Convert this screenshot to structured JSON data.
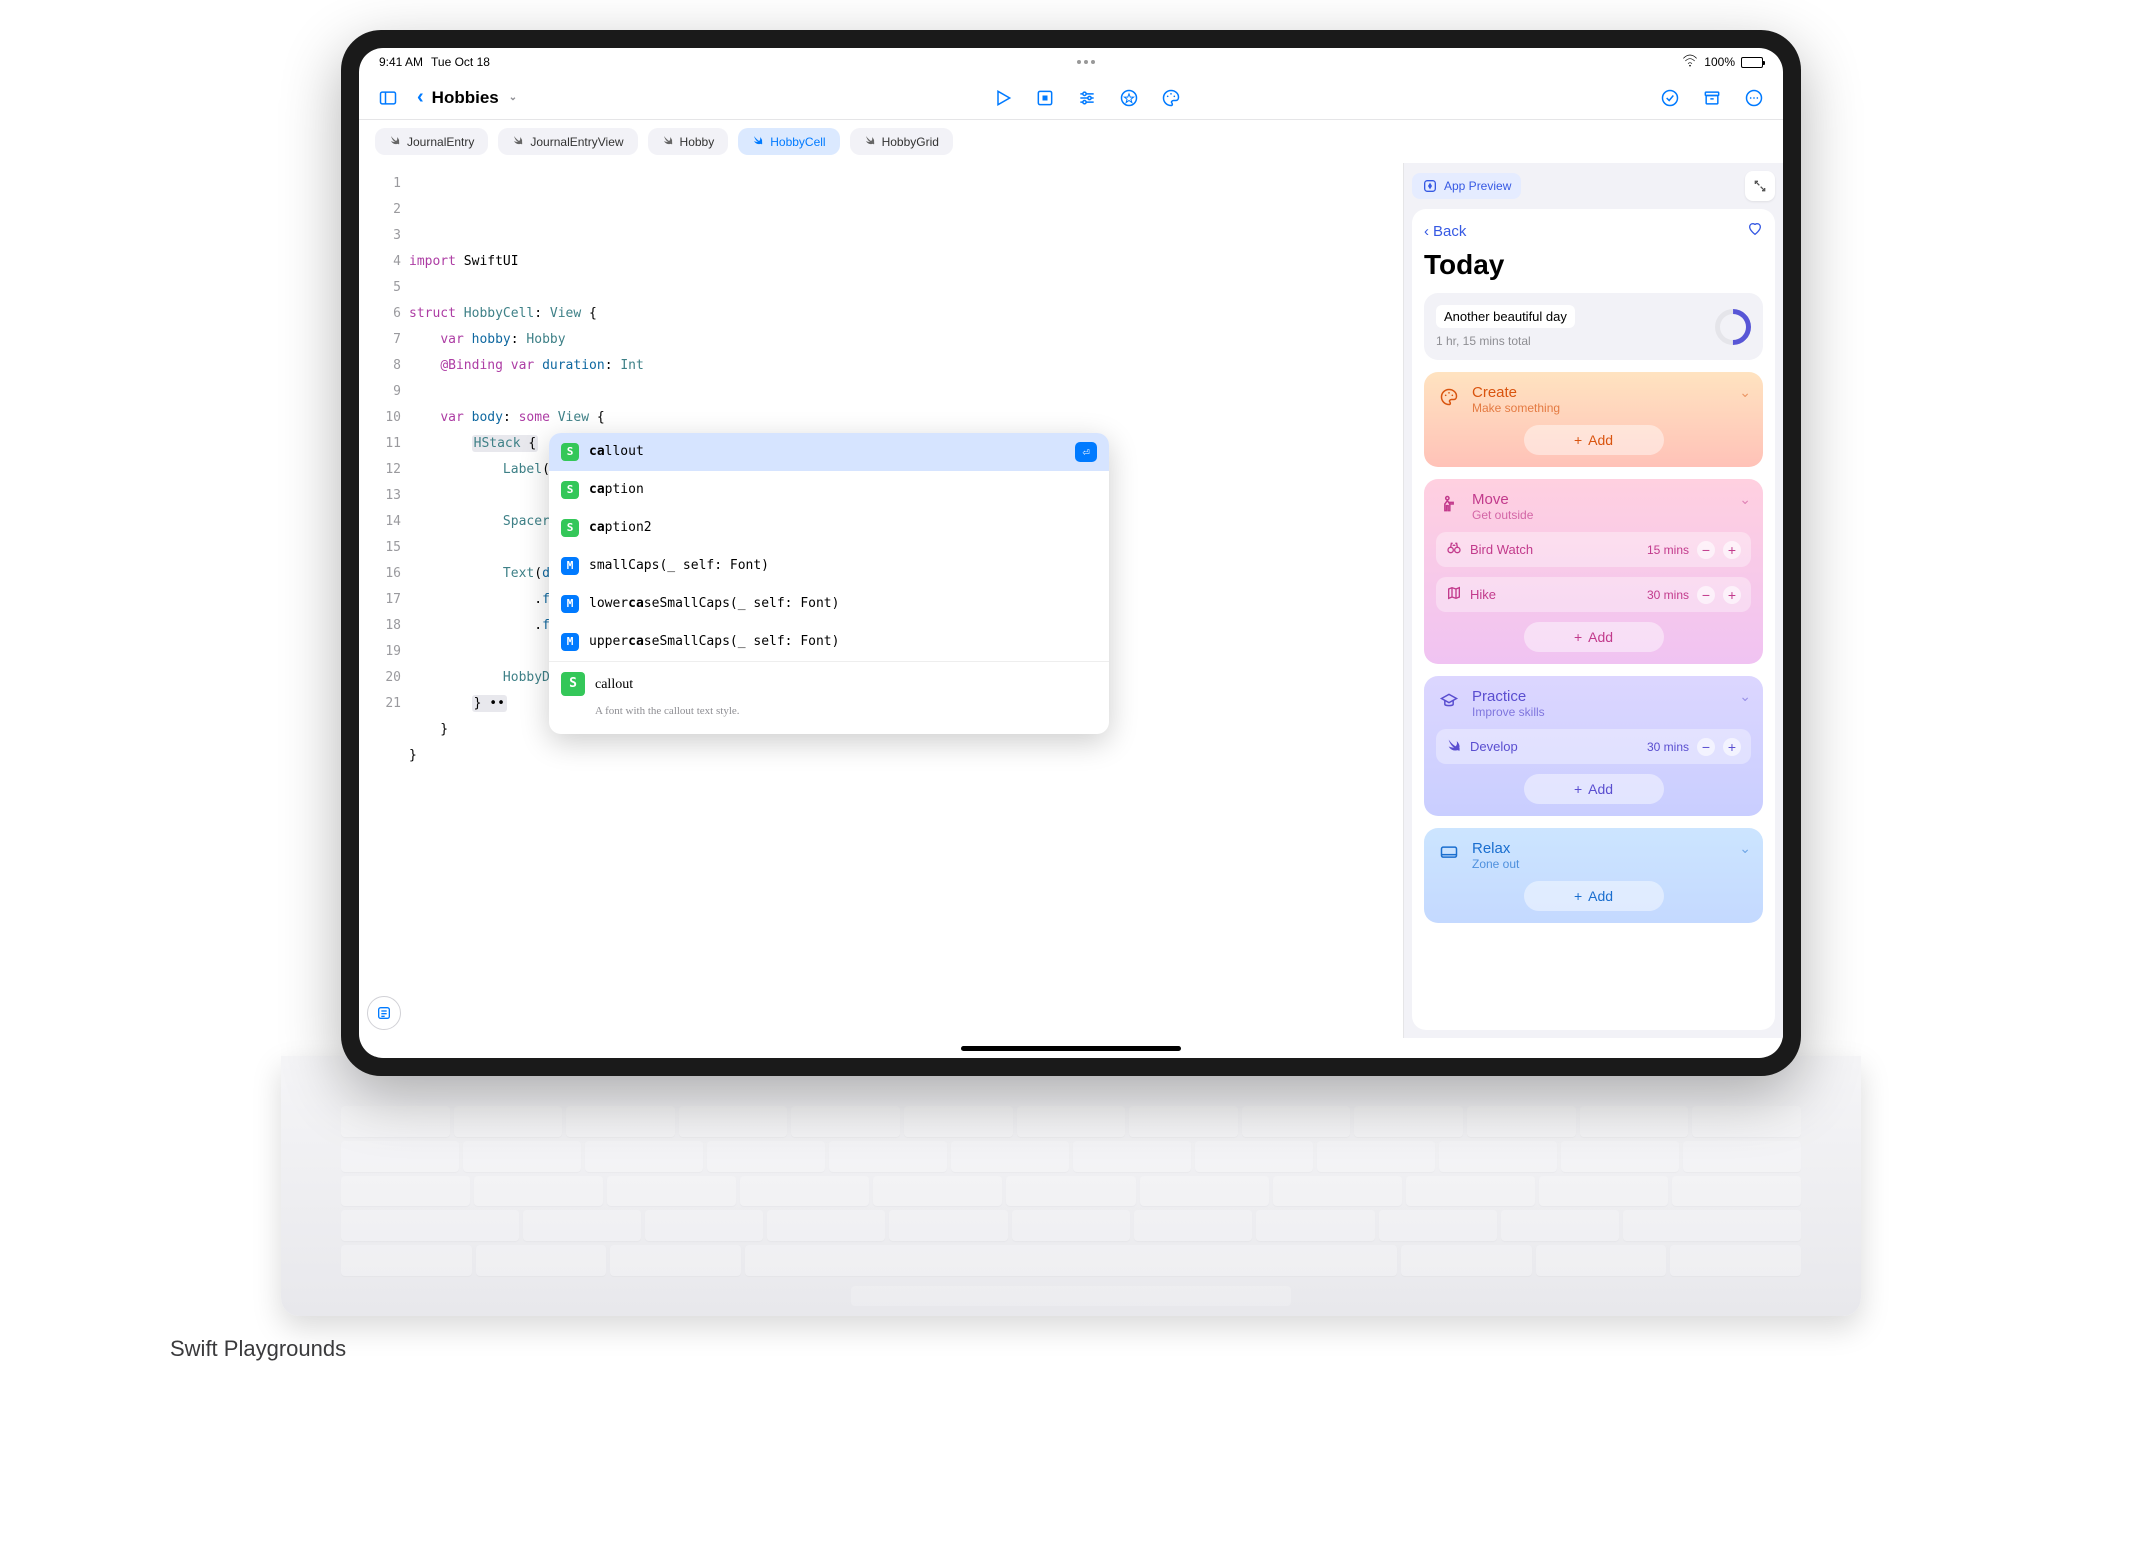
{
  "status": {
    "time": "9:41 AM",
    "date": "Tue Oct 18",
    "wifi": "􀙇",
    "battery": "100%"
  },
  "toolbar": {
    "back_label": "",
    "breadcrumb": "Hobbies"
  },
  "tabs": [
    {
      "label": "JournalEntry",
      "active": false
    },
    {
      "label": "JournalEntryView",
      "active": false
    },
    {
      "label": "Hobby",
      "active": false
    },
    {
      "label": "HobbyCell",
      "active": true
    },
    {
      "label": "HobbyGrid",
      "active": false
    }
  ],
  "code_lines": [
    {
      "n": 1,
      "html": "<span class='kw-pink'>import</span> SwiftUI"
    },
    {
      "n": 2,
      "html": ""
    },
    {
      "n": 3,
      "html": "<span class='kw-pink'>struct</span> <span class='kw-teal'>HobbyCell</span>: <span class='kw-teal'>View</span> {"
    },
    {
      "n": 4,
      "html": "    <span class='kw-pink'>var</span> <span class='kw-blue'>hobby</span>: <span class='kw-teal'>Hobby</span>"
    },
    {
      "n": 5,
      "html": "    <span class='kw-pink'>@Binding</span> <span class='kw-pink'>var</span> <span class='kw-blue'>duration</span>: <span class='kw-teal'>Int</span>"
    },
    {
      "n": 6,
      "html": ""
    },
    {
      "n": 7,
      "html": "    <span class='kw-pink'>var</span> <span class='kw-blue'>body</span>: <span class='kw-pink'>some</span> <span class='kw-teal'>View</span> {"
    },
    {
      "n": 8,
      "html": "        <span class='hl'><span class='kw-teal'>HStack</span> {</span>"
    },
    {
      "n": 9,
      "html": "            <span class='kw-teal'>Label</span>(<span class='kw-blue'>hobby</span>.<span class='kw-blue'>title</span>, systemImage: <span class='kw-blue'>hobby</span>.<span class='kw-blue'>imageName</span>)"
    },
    {
      "n": 10,
      "html": ""
    },
    {
      "n": 11,
      "html": "            <span class='kw-teal'>Spacer</span>()"
    },
    {
      "n": 12,
      "html": ""
    },
    {
      "n": 13,
      "html": "            <span class='kw-teal'>Text</span>(<span class='kw-blue'>duration</span>.<span class='kw-blue'>durationFormatted</span>())"
    },
    {
      "n": 14,
      "html": "                .<span class='kw-blue'>font</span>(.<span class='kw-blue'>ca</span><span class='cursor'></span>)"
    },
    {
      "n": 15,
      "html": "                .<span class='kw-blue'>f</span>"
    },
    {
      "n": 16,
      "html": ""
    },
    {
      "n": 17,
      "html": "            <span class='kw-teal'>HobbyD</span>"
    },
    {
      "n": 18,
      "html": "        <span class='hl'>} ••</span>"
    },
    {
      "n": 19,
      "html": "    }"
    },
    {
      "n": 20,
      "html": "}"
    },
    {
      "n": 21,
      "html": ""
    }
  ],
  "autocomplete": {
    "items": [
      {
        "badge": "S",
        "label_pre": "",
        "label_bold": "ca",
        "label_post": "llout",
        "selected": true,
        "enter": true
      },
      {
        "badge": "S",
        "label_pre": "",
        "label_bold": "ca",
        "label_post": "ption"
      },
      {
        "badge": "S",
        "label_pre": "",
        "label_bold": "ca",
        "label_post": "ption2"
      },
      {
        "badge": "M",
        "label_pre": "smallCaps(_ self: Font)",
        "label_bold": "",
        "label_post": ""
      },
      {
        "badge": "M",
        "label_pre": "lower",
        "label_bold": "ca",
        "label_post": "seSmallCaps(_ self: Font)"
      },
      {
        "badge": "M",
        "label_pre": "upper",
        "label_bold": "ca",
        "label_post": "seSmallCaps(_ self: Font)"
      }
    ],
    "detail": {
      "name": "callout",
      "desc": "A font with the callout text style."
    }
  },
  "preview": {
    "badge": "App Preview",
    "back": "Back",
    "title": "Today",
    "summary": {
      "label": "Another beautiful day",
      "sub": "1 hr, 15 mins total"
    },
    "cards": [
      {
        "theme": "orange",
        "icon": "🎨",
        "name": "Create",
        "sub": "Make something",
        "activities": [],
        "add": "Add"
      },
      {
        "theme": "pink",
        "icon": "🚶",
        "name": "Move",
        "sub": "Get outside",
        "activities": [
          {
            "icon": "binoculars",
            "label": "Bird Watch",
            "dur": "15 mins"
          },
          {
            "icon": "map",
            "label": "Hike",
            "dur": "30 mins"
          }
        ],
        "add": "Add"
      },
      {
        "theme": "purple",
        "icon": "🎓",
        "name": "Practice",
        "sub": "Improve skills",
        "activities": [
          {
            "icon": "swift",
            "label": "Develop",
            "dur": "30 mins"
          }
        ],
        "add": "Add"
      },
      {
        "theme": "blue",
        "icon": "🖥",
        "name": "Relax",
        "sub": "Zone out",
        "activities": [],
        "add": "Add"
      }
    ]
  },
  "caption": "Swift Playgrounds"
}
